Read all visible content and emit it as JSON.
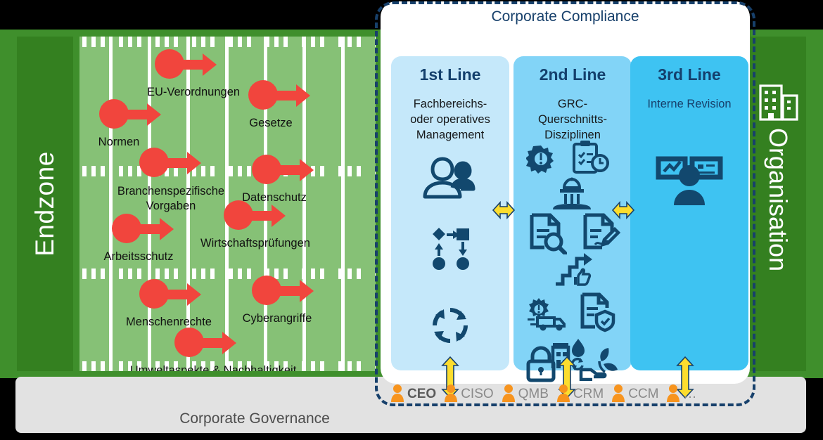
{
  "field": {
    "endzone_label": "Endzone",
    "organisation_label": "Organisation",
    "organisation_icon": "office-building-icon",
    "items": [
      {
        "label": "EU-Verordnungen",
        "icon": "red-dot-icon",
        "arrow": "red-arrow-icon"
      },
      {
        "label": "Normen",
        "icon": "red-dot-icon",
        "arrow": "red-arrow-icon"
      },
      {
        "label": "Branchenspezifische Vorgaben",
        "icon": "red-dot-icon",
        "arrow": "red-arrow-icon"
      },
      {
        "label": "Arbeitsschutz",
        "icon": "red-dot-icon",
        "arrow": "red-arrow-icon"
      },
      {
        "label": "Menschenrechte",
        "icon": "red-dot-icon",
        "arrow": "red-arrow-icon"
      },
      {
        "label": "Umweltaspekte & Nachhaltigkeit",
        "icon": "red-dot-icon",
        "arrow": "red-arrow-icon"
      },
      {
        "label": "Gesetze",
        "icon": "red-dot-icon",
        "arrow": "red-arrow-icon"
      },
      {
        "label": "Datenschutz",
        "icon": "red-dot-icon",
        "arrow": "red-arrow-icon"
      },
      {
        "label": "Wirtschaftsprüfungen",
        "icon": "red-dot-icon",
        "arrow": "red-arrow-icon"
      },
      {
        "label": "Cyberangriffe",
        "icon": "red-dot-icon",
        "arrow": "red-arrow-icon"
      }
    ]
  },
  "compliance": {
    "title": "Corporate Compliance",
    "columns": [
      {
        "title": "1st Line",
        "subtitle": "Fachbereichs-\noder operatives\nManagement",
        "icons": [
          "two-people-icon",
          "process-flow-icon",
          "cycle-refresh-icon"
        ]
      },
      {
        "title": "2nd Line",
        "subtitle": "GRC-\nQuerschnitts-\nDisziplinen",
        "icons": [
          "gear-alert-icon",
          "clipboard-clock-icon",
          "government-building-icon",
          "document-search-icon",
          "document-signature-icon",
          "stairs-thumbsup-icon",
          "truck-alert-icon",
          "document-shield-icon",
          "factory-recycle-icon",
          "padlock-icon",
          "hand-plant-icon"
        ]
      },
      {
        "title": "3rd Line",
        "subtitle": "Interne Revision",
        "icons": [
          "audit-person-dashboard-icon"
        ]
      }
    ]
  },
  "governance": {
    "title": "Corporate Governance",
    "roles": [
      {
        "label": "CEO",
        "icon": "person-icon",
        "active": true
      },
      {
        "label": "CISO",
        "icon": "person-icon",
        "active": false
      },
      {
        "label": "QMB",
        "icon": "person-icon",
        "active": false
      },
      {
        "label": "CRM",
        "icon": "person-icon",
        "active": false
      },
      {
        "label": "CCM",
        "icon": "person-icon",
        "active": false
      },
      {
        "label": "…",
        "icon": "person-icon",
        "active": false
      }
    ]
  },
  "colors": {
    "field_light_green": "#86c176",
    "field_dark_green": "#348020",
    "red_marker": "#f1453d",
    "line1_blue": "#c5e8fa",
    "line2_blue": "#82d4f7",
    "line3_blue": "#3ec3f2",
    "navy": "#17406b",
    "yellow_arrow": "#fcdd2e",
    "person_orange": "#f7941e",
    "governance_gray": "#e2e2e2"
  }
}
